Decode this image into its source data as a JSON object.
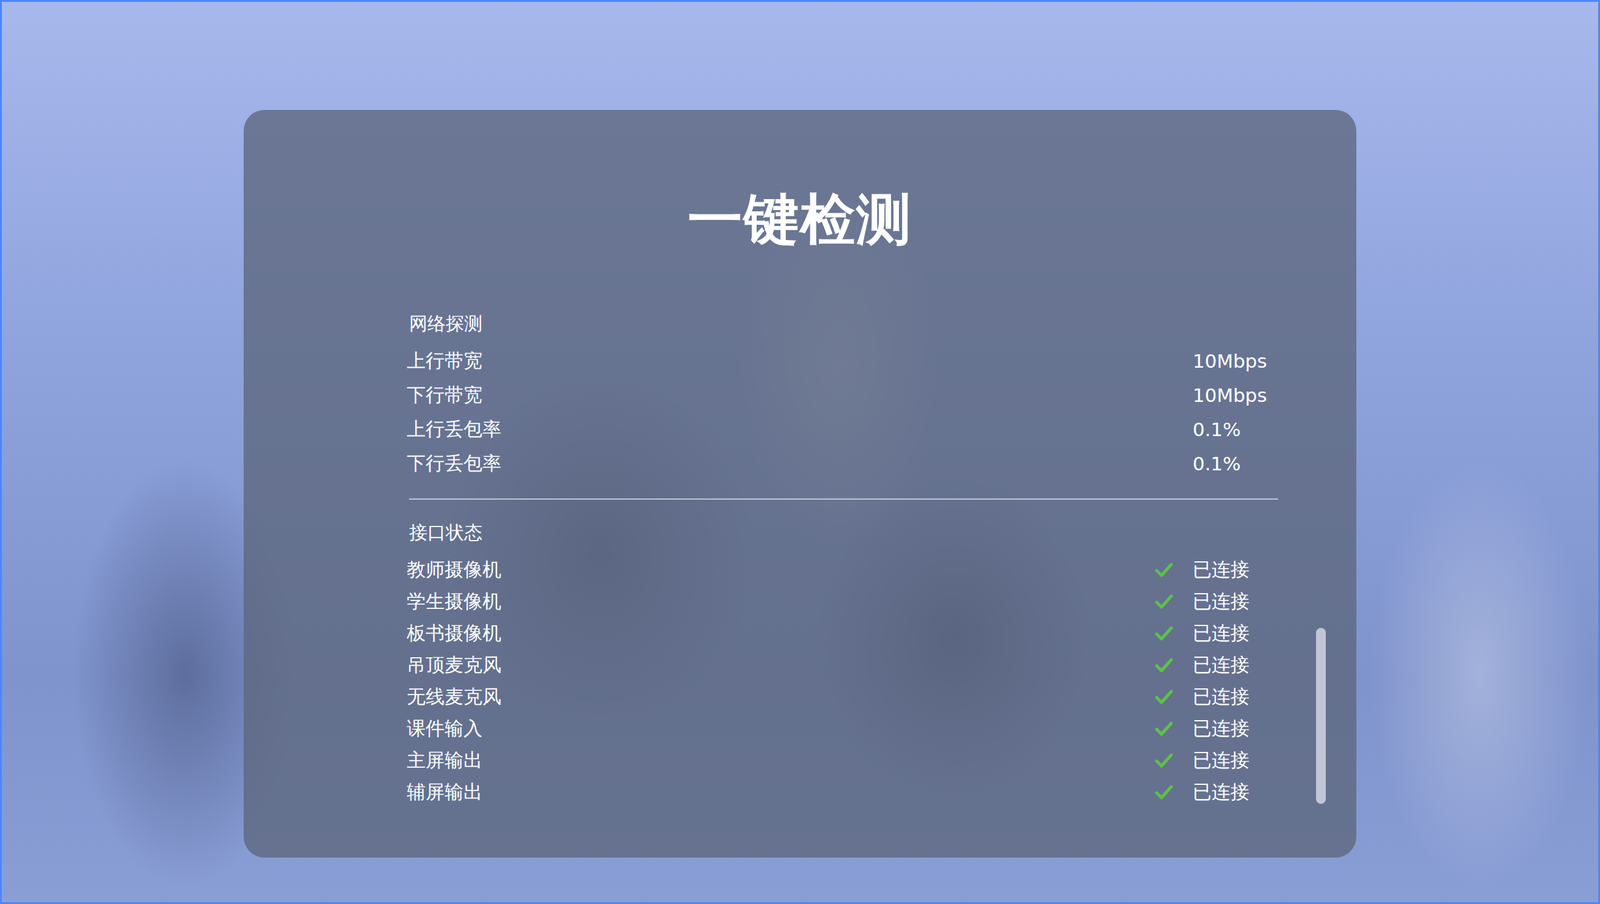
{
  "title": "一键检测",
  "network": {
    "title": "网络探测",
    "rows": [
      {
        "label": "上行带宽",
        "value": "10Mbps"
      },
      {
        "label": "下行带宽",
        "value": "10Mbps"
      },
      {
        "label": "上行丢包率",
        "value": "0.1%"
      },
      {
        "label": "下行丢包率",
        "value": "0.1%"
      }
    ]
  },
  "interfaces": {
    "title": "接口状态",
    "rows": [
      {
        "label": "教师摄像机",
        "status": "已连接",
        "connected": true
      },
      {
        "label": "学生摄像机",
        "status": "已连接",
        "connected": true
      },
      {
        "label": "板书摄像机",
        "status": "已连接",
        "connected": true
      },
      {
        "label": "吊顶麦克风",
        "status": "已连接",
        "connected": true
      },
      {
        "label": "无线麦克风",
        "status": "已连接",
        "connected": true
      },
      {
        "label": "课件输入",
        "status": "已连接",
        "connected": true
      },
      {
        "label": "主屏输出",
        "status": "已连接",
        "connected": true
      },
      {
        "label": "辅屏输出",
        "status": "已连接",
        "connected": true
      }
    ]
  }
}
